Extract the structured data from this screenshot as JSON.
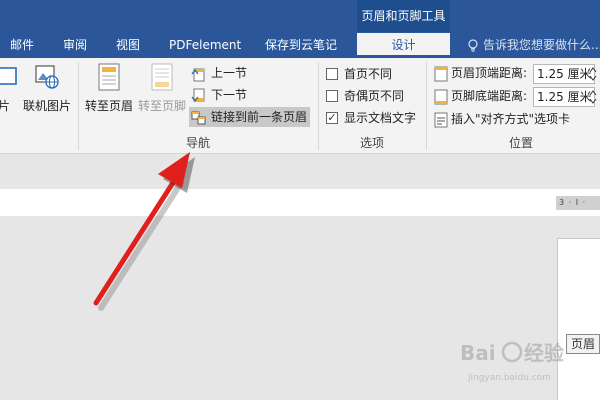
{
  "tabbar": {
    "context_title": "页眉和页脚工具",
    "tabs": [
      {
        "label": "邮件"
      },
      {
        "label": "审阅"
      },
      {
        "label": "视图"
      },
      {
        "label": "PDFelement"
      },
      {
        "label": "保存到云笔记"
      },
      {
        "label": "设计",
        "active": true
      }
    ],
    "tell_me": "告诉我您想要做什么..."
  },
  "ribbon": {
    "insert_group": {
      "partial_picture_label": "片",
      "online_picture_label": "联机图片"
    },
    "navigation": {
      "goto_header_label": "转至页眉",
      "goto_footer_label": "转至页脚",
      "previous_label": "上一节",
      "next_label": "下一节",
      "link_previous_label": "链接到前一条页眉",
      "group_label": "导航"
    },
    "options": {
      "different_first_label": "首页不同",
      "different_first_checked": false,
      "odd_even_label": "奇偶页不同",
      "odd_even_checked": false,
      "show_text_label": "显示文档文字",
      "show_text_checked": true,
      "checkmark": "✓",
      "group_label": "选项"
    },
    "position": {
      "header_top_label": "页眉顶端距离:",
      "header_top_value": "1.25 厘米",
      "footer_bottom_label": "页脚底端距离:",
      "footer_bottom_value": "1.25 厘米",
      "insert_align_tab_label": "插入\"对齐方式\"选项卡",
      "group_label": "位置"
    }
  },
  "document": {
    "ruler_marks": "3 · I ·",
    "header_tag": "页眉"
  },
  "watermark": {
    "brand": "Bai",
    "brand2": "经验",
    "url": "jingyan.baidu.com"
  },
  "colors": {
    "ribbon_blue": "#2b579a",
    "arrow_red": "#e0201c"
  }
}
